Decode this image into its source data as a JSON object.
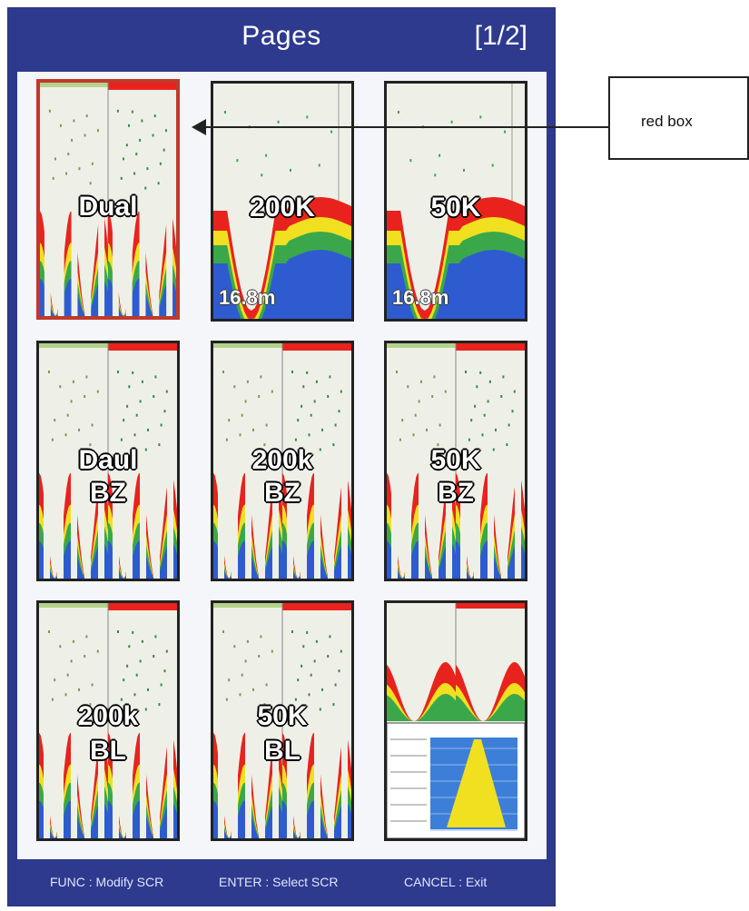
{
  "header": {
    "title": "Pages",
    "page_indicator": "[1/2]"
  },
  "thumbnails": [
    {
      "line1": "Dual",
      "line2": "",
      "selected": true,
      "style": "dual"
    },
    {
      "line1": "200K",
      "line2": "",
      "depth": "16.8m",
      "style": "single"
    },
    {
      "line1": "50K",
      "line2": "",
      "depth": "16.8m",
      "style": "single"
    },
    {
      "line1": "Daul",
      "line2": "BZ",
      "style": "dual"
    },
    {
      "line1": "200k",
      "line2": "BZ",
      "style": "dual"
    },
    {
      "line1": "50K",
      "line2": "BZ",
      "style": "dual"
    },
    {
      "line1": "200k",
      "line2": "BL",
      "style": "dual"
    },
    {
      "line1": "50K",
      "line2": "BL",
      "style": "dual"
    },
    {
      "line1": "",
      "line2": "",
      "style": "combo"
    }
  ],
  "footer": {
    "func": "FUNC : Modify SCR",
    "enter": "ENTER : Select SCR",
    "cancel": "CANCEL : Exit"
  },
  "callout": {
    "text": "red box"
  },
  "colors": {
    "frame": "#2e3a8e",
    "selected_border": "#c0392b",
    "echo_red": "#e8231d",
    "echo_yellow": "#f0e020",
    "echo_green": "#3aa84a",
    "echo_blue": "#2f5bd0"
  }
}
